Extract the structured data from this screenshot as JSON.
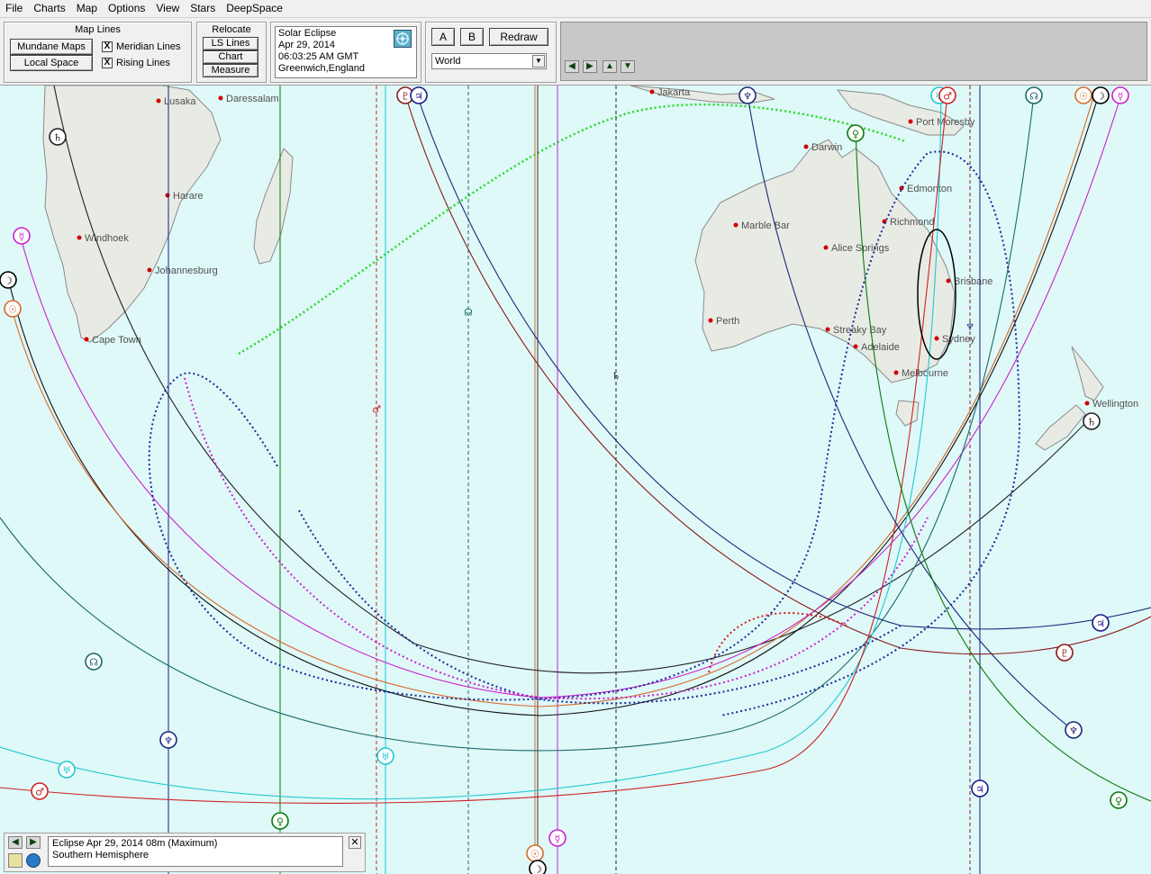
{
  "menu": [
    "File",
    "Charts",
    "Map",
    "Options",
    "View",
    "Stars",
    "DeepSpace"
  ],
  "map_lines": {
    "title": "Map Lines",
    "mundane_button": "Mundane Maps",
    "local_button": "Local Space",
    "meridian_label": "Meridian Lines",
    "rising_label": "Rising Lines",
    "meridian_checked": "X",
    "rising_checked": "X"
  },
  "relocate": {
    "title": "Relocate",
    "ls_lines": "LS  Lines",
    "chart": "Chart",
    "measure": "Measure"
  },
  "chart_info": {
    "line1": "Solar Eclipse",
    "line2": "Apr 29, 2014",
    "line3": "06:03:25 AM GMT",
    "line4": "Greenwich,England"
  },
  "buttons": {
    "a": "A",
    "b": "B",
    "redraw": "Redraw"
  },
  "region_select": {
    "value": "World",
    "arrow_icon": "dropdown-arrow-icon"
  },
  "nav_icons": [
    "arrow-left-icon",
    "arrow-right-icon",
    "arrow-up-icon",
    "arrow-down-icon"
  ],
  "cities": [
    "Lusaka",
    "Daressalam",
    "Harare",
    "Windhoek",
    "Johannesburg",
    "Cape Town",
    "Jakarta",
    "Port Moresby",
    "Darwin",
    "Edmonton",
    "Richmond",
    "Marble Bar",
    "Alice Springs",
    "Brisbane",
    "Perth",
    "Streaky Bay",
    "Adelaide",
    "Sydney",
    "Melbourne",
    "Wellington"
  ],
  "status": {
    "line1": "Eclipse Apr 29, 2014 08m (Maximum)",
    "line2": "Southern Hemisphere",
    "close": "✕"
  },
  "colors": {
    "map_background": "#dff8f8",
    "land": "#e8ebe4",
    "sun": "#d86a2a",
    "moon": "#000000",
    "mercury": "#cc22cc",
    "venus": "#0a7a0a",
    "mars": "#cc2222",
    "jupiter": "#1a1a8a",
    "saturn": "#222222",
    "uranus": "#22c8d0",
    "neptune": "#1a2a7a",
    "pluto": "#8a1a1a",
    "node": "#1a6a6a",
    "eclipse_path": "#22dd22"
  }
}
